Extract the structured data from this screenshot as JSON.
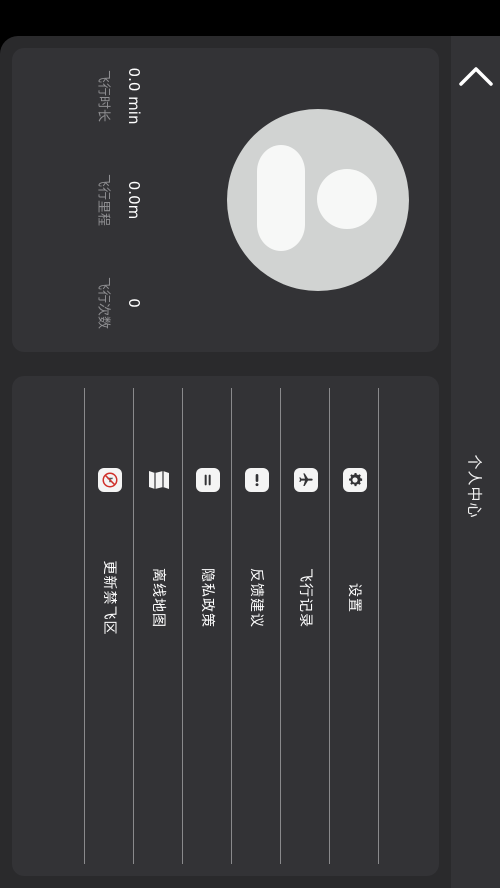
{
  "header": {
    "title": "个人中心",
    "back_icon": "chevron-up-icon"
  },
  "stats": {
    "flight_time": {
      "value": "0.0 min",
      "label": "飞行时长"
    },
    "flight_distance": {
      "value": "0.0m",
      "label": "飞行里程"
    },
    "flight_count": {
      "value": "0",
      "label": "飞行次数"
    }
  },
  "avatar": {
    "icon": "user-avatar-icon"
  },
  "menu": {
    "items": [
      {
        "label": "设置",
        "icon": "gear-icon"
      },
      {
        "label": "飞行记录",
        "icon": "airplane-icon"
      },
      {
        "label": "反馈建议",
        "icon": "exclamation-icon"
      },
      {
        "label": "隐私政策",
        "icon": "policy-icon"
      },
      {
        "label": "离线地图",
        "icon": "map-icon"
      },
      {
        "label": "更新禁飞区",
        "icon": "no-fly-zone-icon"
      }
    ]
  },
  "colors": {
    "background": "#2a2a2c",
    "panel": "#333336",
    "avatar_bg": "#d1d3d2",
    "no_fly_red": "#d0302a"
  }
}
